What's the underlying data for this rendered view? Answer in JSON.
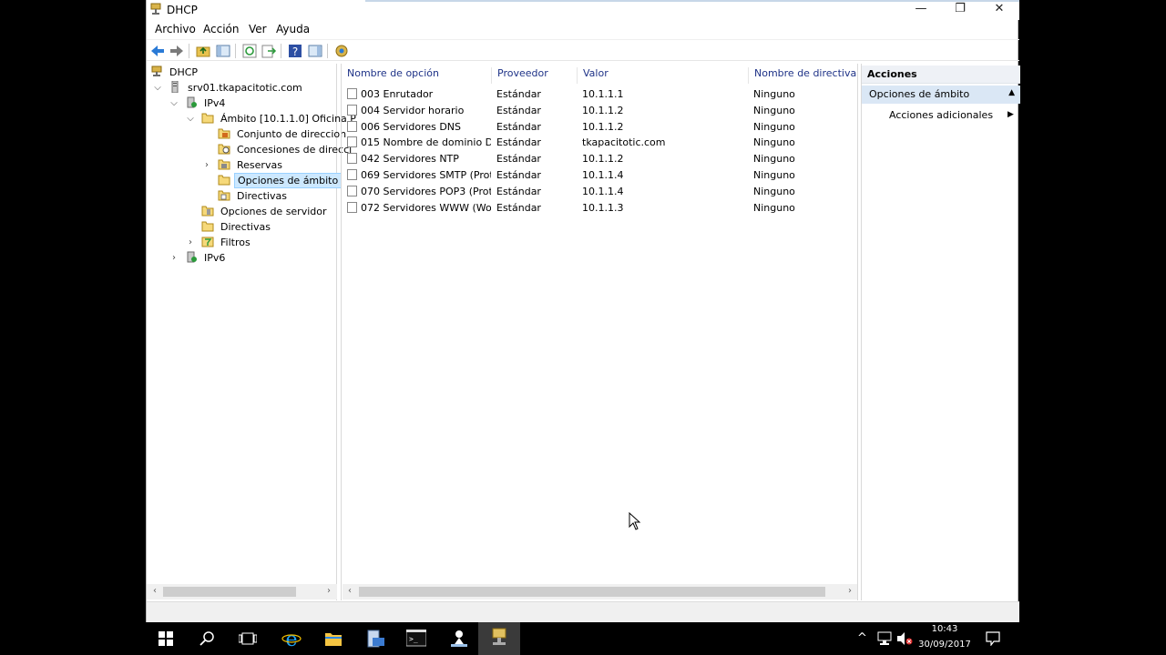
{
  "window": {
    "title": "DHCP",
    "controls": {
      "minimize": "—",
      "restore": "❐",
      "close": "✕"
    }
  },
  "menu": [
    "Archivo",
    "Acción",
    "Ver",
    "Ayuda"
  ],
  "tree": {
    "root": "DHCP",
    "server": "srv01.tkapacitotic.com",
    "ipv4": "IPv4",
    "scope": "Ámbito [10.1.1.0] Oficina P",
    "scope_children": [
      "Conjunto de direccion",
      "Concesiones de direcci",
      "Reservas",
      "Opciones de ámbito",
      "Directivas"
    ],
    "server_options": "Opciones de servidor",
    "policies": "Directivas",
    "filters": "Filtros",
    "ipv6": "IPv6",
    "selected": "Opciones de ámbito"
  },
  "list": {
    "columns": [
      "Nombre de opción",
      "Proveedor",
      "Valor",
      "Nombre de directiva"
    ],
    "rows": [
      [
        "003 Enrutador",
        "Estándar",
        "10.1.1.1",
        "Ninguno"
      ],
      [
        "004 Servidor horario",
        "Estándar",
        "10.1.1.2",
        "Ninguno"
      ],
      [
        "006 Servidores DNS",
        "Estándar",
        "10.1.1.2",
        "Ninguno"
      ],
      [
        "015 Nombre de dominio D...",
        "Estándar",
        "tkapacitotic.com",
        "Ninguno"
      ],
      [
        "042 Servidores NTP",
        "Estándar",
        "10.1.1.2",
        "Ninguno"
      ],
      [
        "069 Servidores SMTP (Prot...",
        "Estándar",
        "10.1.1.4",
        "Ninguno"
      ],
      [
        "070 Servidores POP3 (Prot...",
        "Estándar",
        "10.1.1.4",
        "Ninguno"
      ],
      [
        "072 Servidores WWW (Wor...",
        "Estándar",
        "10.1.1.3",
        "Ninguno"
      ]
    ]
  },
  "actions": {
    "header": "Acciones",
    "group": "Opciones de ámbito",
    "item": "Acciones adicionales"
  },
  "taskbar": {
    "time": "10:43",
    "date": "30/09/2017"
  },
  "colors": {
    "selection": "#cce8ff",
    "header_text": "#1e3287",
    "actions_group": "#dae7f5"
  }
}
